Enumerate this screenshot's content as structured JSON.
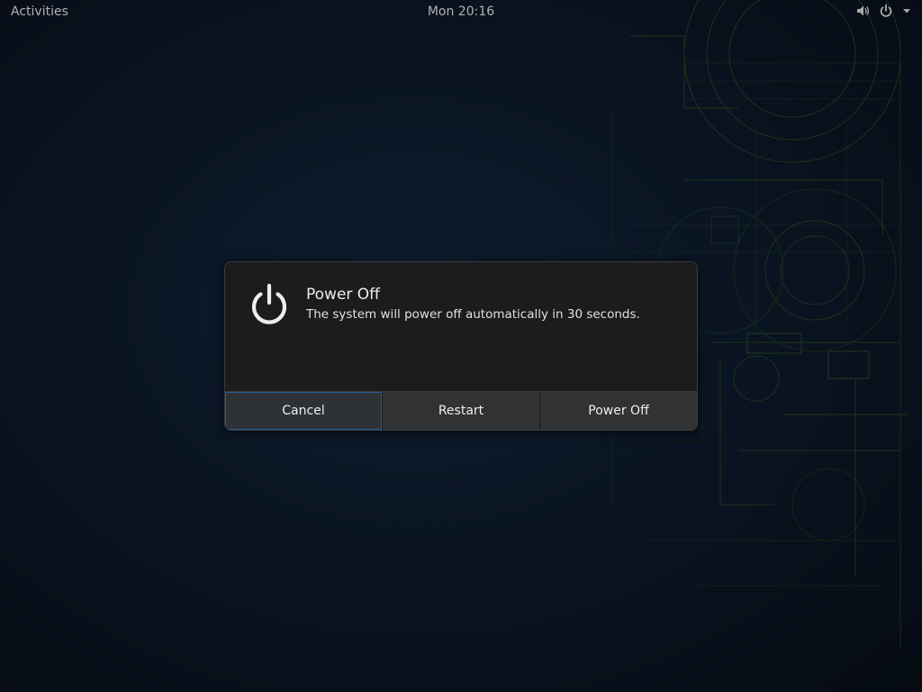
{
  "topbar": {
    "activities_label": "Activities",
    "clock": "Mon 20:16",
    "status_icons": [
      "speaker-icon",
      "power-icon",
      "dropdown-arrow-icon"
    ]
  },
  "dialog": {
    "icon": "power-icon",
    "title": "Power Off",
    "message": "The system will power off automatically in 30 seconds.",
    "buttons": {
      "cancel": "Cancel",
      "restart": "Restart",
      "power_off": "Power Off"
    },
    "focused_button": "cancel",
    "accent_color": "#215d9c"
  }
}
